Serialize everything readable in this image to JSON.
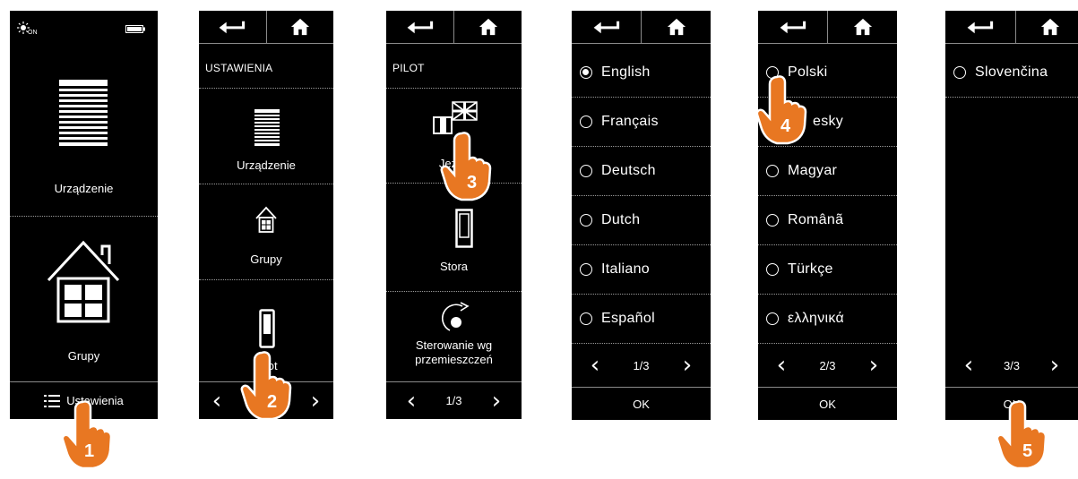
{
  "colors": {
    "screen_bg": "#000000",
    "accent_hand": "#e87722",
    "divider": "#8a8a8a"
  },
  "screen1": {
    "status_icon": "sun-on-icon",
    "status_label": "ON",
    "battery_icon": "battery-icon",
    "items": [
      {
        "icon": "blind-icon",
        "label": "Urządzenie"
      },
      {
        "icon": "house-group-icon",
        "label": "Grupy"
      }
    ],
    "footer_icon": "list-icon",
    "footer_label": "Ustawienia"
  },
  "screen2": {
    "title": "USTAWIENIA",
    "items": [
      {
        "icon": "blind-icon",
        "label": "Urządzenie"
      },
      {
        "icon": "house-group-icon",
        "label": "Grupy"
      },
      {
        "icon": "remote-icon",
        "label": "Pilot"
      }
    ]
  },
  "screen3": {
    "title": "PILOT",
    "items": [
      {
        "icon": "flag-icon",
        "label": "Język"
      },
      {
        "icon": "blind-switch-icon",
        "label": "Stora"
      },
      {
        "icon": "motion-control-icon",
        "label_line1": "Sterowanie wg",
        "label_line2": "przemieszczeń"
      }
    ],
    "page": "1/3"
  },
  "screen4": {
    "languages": [
      {
        "name": "English",
        "selected": true
      },
      {
        "name": "Français",
        "selected": false
      },
      {
        "name": "Deutsch",
        "selected": false
      },
      {
        "name": "Dutch",
        "selected": false
      },
      {
        "name": "Italiano",
        "selected": false
      },
      {
        "name": "Español",
        "selected": false
      }
    ],
    "page": "1/3",
    "ok": "OK"
  },
  "screen5": {
    "languages": [
      {
        "name": "Polski",
        "selected": false
      },
      {
        "name": "esky",
        "selected": false
      },
      {
        "name": "Magyar",
        "selected": false
      },
      {
        "name": "Românã",
        "selected": false
      },
      {
        "name": "Türkçe",
        "selected": false
      },
      {
        "name": "ελληνικά",
        "selected": false
      }
    ],
    "page": "2/3",
    "ok": "OK"
  },
  "screen6": {
    "languages": [
      {
        "name": "Slovenčina",
        "selected": false
      }
    ],
    "page": "3/3",
    "ok": "OK"
  },
  "steps": [
    "1",
    "2",
    "3",
    "4",
    "5"
  ]
}
